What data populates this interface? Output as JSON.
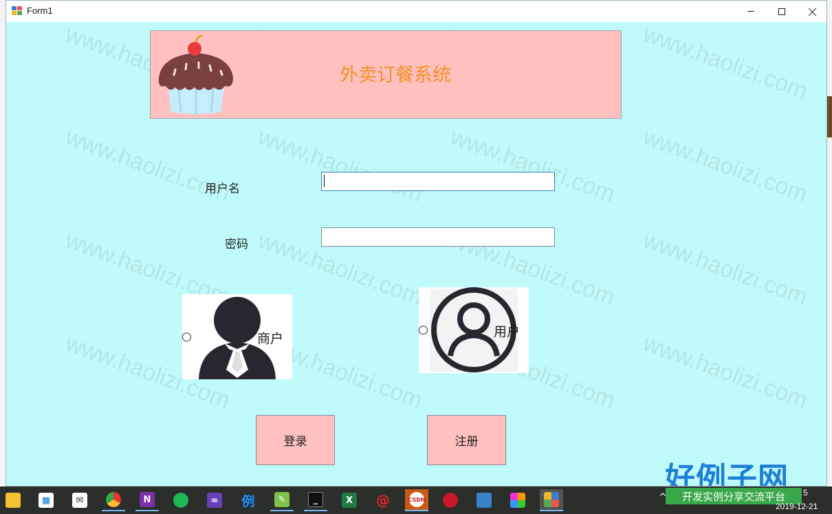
{
  "window": {
    "title": "Form1"
  },
  "banner": {
    "title": "外卖订餐系统"
  },
  "form": {
    "username_label": "用户名",
    "password_label": "密码",
    "username_value": "",
    "password_value": ""
  },
  "roles": {
    "merchant_label": "商户",
    "user_label": "用户"
  },
  "buttons": {
    "login": "登录",
    "register": "注册"
  },
  "watermark": {
    "text": "www.haolizi.com",
    "brand": "好例子网"
  },
  "taskbar": {
    "tray_banner": "开发实例分享交流平台",
    "time": "5",
    "date": "2019-12-21",
    "apps": [
      "file-explorer",
      "store",
      "mail",
      "chrome",
      "onenote",
      "green-app",
      "visual-studio",
      "li-app",
      "notepad",
      "terminal",
      "excel",
      "red-app",
      "csdn",
      "red-circle-app",
      "ide-app",
      "color-app",
      "form-app"
    ]
  },
  "colors": {
    "client_bg": "#c0fbfb",
    "banner_bg": "#ffc0c0",
    "banner_title": "#f39022",
    "button_bg": "#ffc0c0",
    "brand": "#1f7fd6"
  }
}
